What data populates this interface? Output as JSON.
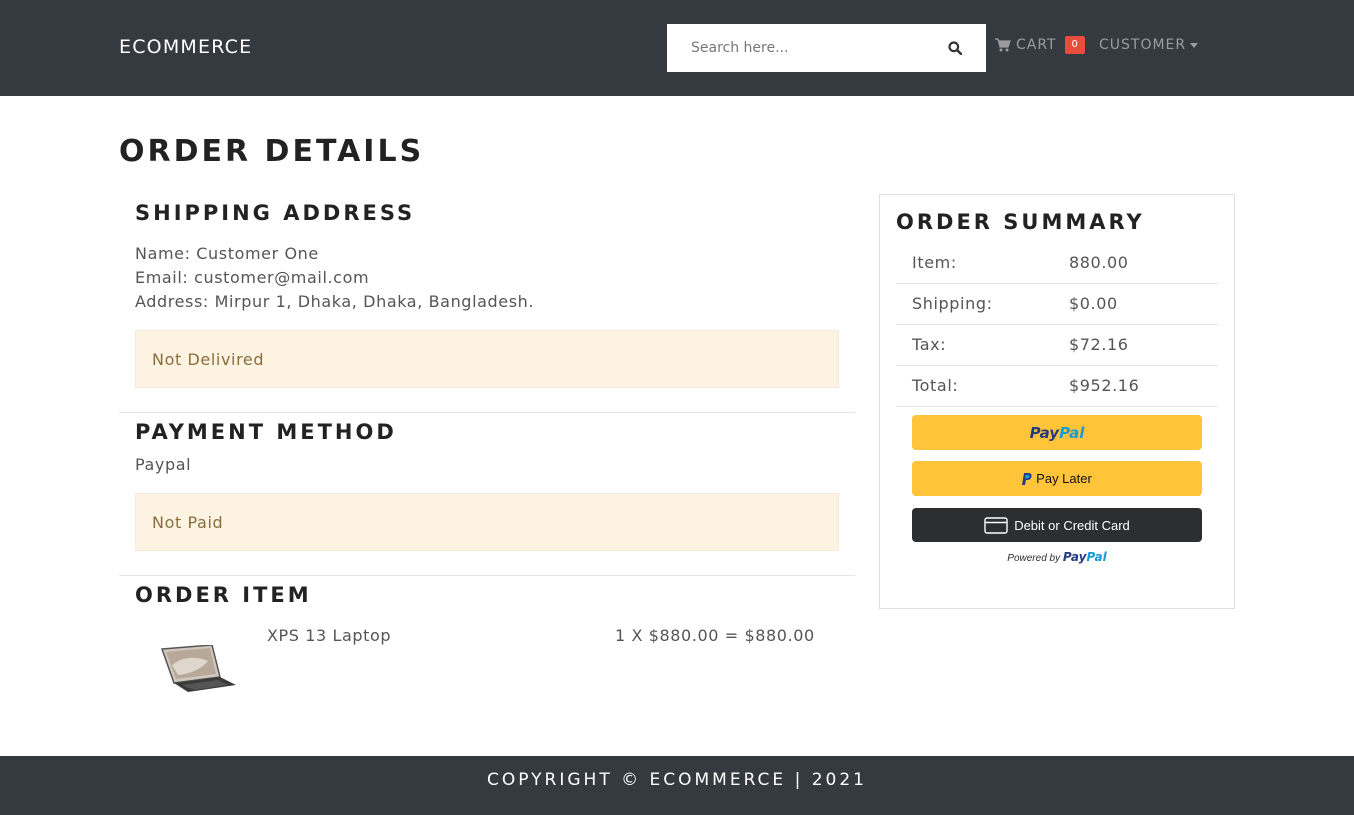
{
  "navbar": {
    "brand": "ECOMMERCE",
    "search_placeholder": "Search here...",
    "cart_label": "CART",
    "cart_count": "0",
    "customer_label": "CUSTOMER",
    "bg_color": "#343a40"
  },
  "page": {
    "title": "ORDER DETAILS"
  },
  "shipping": {
    "heading": "SHIPPING ADDRESS",
    "name": "Name: Customer One",
    "email": "Email: customer@mail.com",
    "address": "Address: Mirpur 1, Dhaka, Dhaka, Bangladesh.",
    "status": "Not Delivired"
  },
  "payment": {
    "heading": "PAYMENT METHOD",
    "method": "Paypal",
    "status": "Not Paid"
  },
  "order_items": {
    "heading": "ORDER ITEM",
    "items": [
      {
        "name": "XPS 13 Laptop",
        "calc": "1 X $880.00 = $880.00",
        "image_icon": "laptop-image"
      }
    ]
  },
  "summary": {
    "heading": "ORDER SUMMARY",
    "rows": [
      {
        "label": "Item:",
        "value": "880.00"
      },
      {
        "label": "Shipping:",
        "value": "$0.00"
      },
      {
        "label": "Tax:",
        "value": "$72.16"
      },
      {
        "label": "Total:",
        "value": "$952.16"
      }
    ]
  },
  "paypal": {
    "logo_pay": "Pay",
    "logo_pal": "Pal",
    "pay_later": "Pay Later",
    "card": "Debit or Credit Card",
    "powered_by": "Powered by",
    "button_color": "#ffc439",
    "card_button_color": "#2c2e2f"
  },
  "footer": {
    "text": "COPYRIGHT © ECOMMERCE | 2021"
  }
}
